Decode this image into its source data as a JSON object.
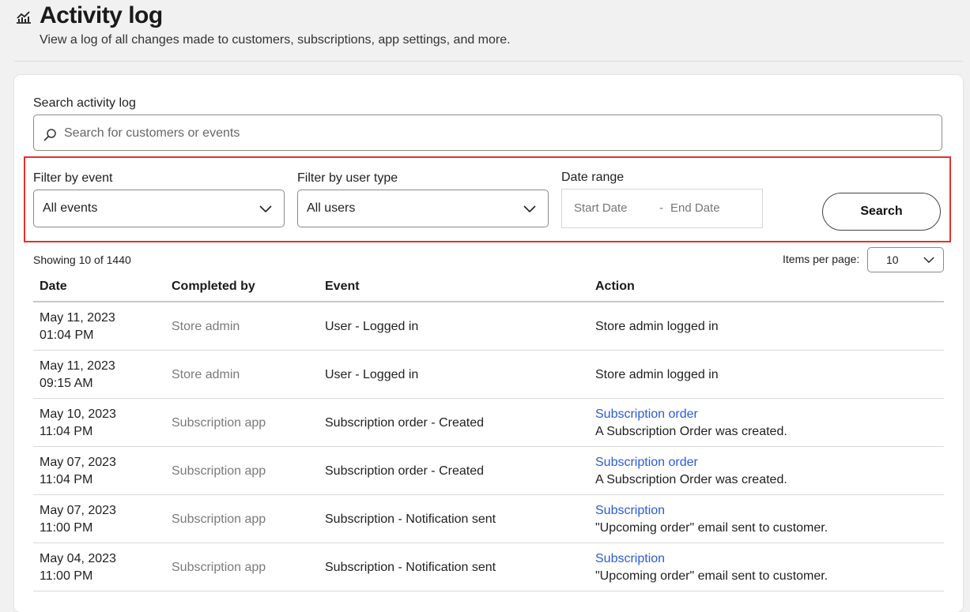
{
  "header": {
    "title": "Activity log",
    "subtitle": "View a log of all changes made to customers, subscriptions, app settings, and more.",
    "icon": "analytics-chart-icon"
  },
  "search": {
    "label": "Search activity log",
    "placeholder": "Search for customers or events",
    "value": ""
  },
  "filters": {
    "event_label": "Filter by event",
    "event_value": "All events",
    "user_type_label": "Filter by user type",
    "user_type_value": "All users",
    "date_label": "Date range",
    "start_placeholder": "Start Date",
    "date_separator": "-",
    "end_placeholder": "End Date",
    "search_button": "Search"
  },
  "results": {
    "showing": "Showing 10 of 1440",
    "items_per_page_label": "Items per page:",
    "items_per_page_value": "10"
  },
  "table": {
    "columns": [
      "Date",
      "Completed by",
      "Event",
      "Action"
    ],
    "rows": [
      {
        "date": "May 11, 2023",
        "time": "01:04 PM",
        "by": "Store admin",
        "event": "User - Logged in",
        "action_link": "",
        "action": "Store admin logged in"
      },
      {
        "date": "May 11, 2023",
        "time": "09:15 AM",
        "by": "Store admin",
        "event": "User - Logged in",
        "action_link": "",
        "action": "Store admin logged in"
      },
      {
        "date": "May 10, 2023",
        "time": "11:04 PM",
        "by": "Subscription app",
        "event": "Subscription order - Created",
        "action_link": "Subscription order",
        "action": "A Subscription Order was created."
      },
      {
        "date": "May 07, 2023",
        "time": "11:04 PM",
        "by": "Subscription app",
        "event": "Subscription order - Created",
        "action_link": "Subscription order",
        "action": "A Subscription Order was created."
      },
      {
        "date": "May 07, 2023",
        "time": "11:00 PM",
        "by": "Subscription app",
        "event": "Subscription - Notification sent",
        "action_link": "Subscription",
        "action": "\"Upcoming order\" email sent to customer."
      },
      {
        "date": "May 04, 2023",
        "time": "11:00 PM",
        "by": "Subscription app",
        "event": "Subscription - Notification sent",
        "action_link": "Subscription",
        "action": "\"Upcoming order\" email sent to customer."
      }
    ]
  },
  "colors": {
    "highlight_border": "#e5312b",
    "link": "#2a5bd7",
    "muted_text": "#7a7a7a"
  }
}
